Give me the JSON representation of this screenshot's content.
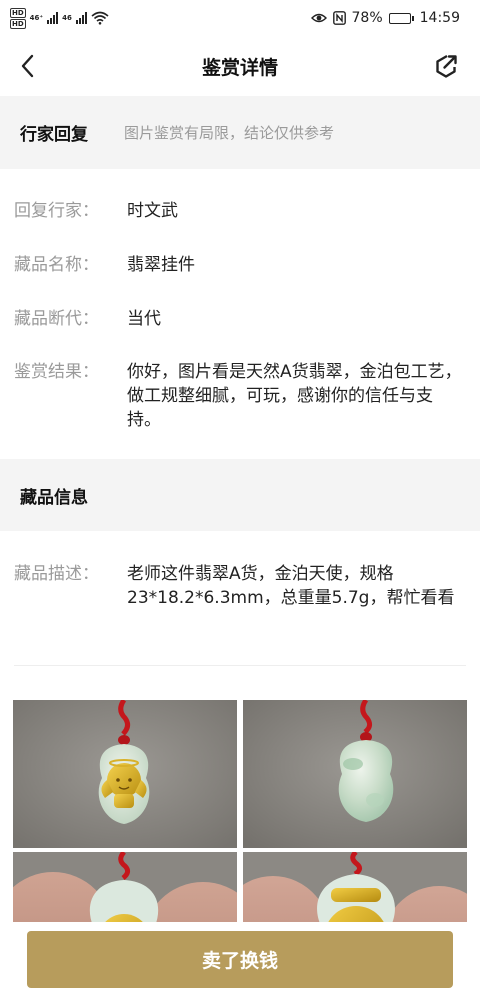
{
  "status": {
    "hd1": "HD",
    "hd2": "HD",
    "net1": "46⁺",
    "net2": "46",
    "battery": "78%",
    "time": "14:59",
    "battery_level": 0.78
  },
  "nav": {
    "title": "鉴赏详情",
    "back_icon": "chevron-left-icon",
    "share_icon": "share-icon"
  },
  "expert_section": {
    "title": "行家回复",
    "note": "图片鉴赏有局限，结论仅供参考"
  },
  "expert_rows": [
    {
      "label": "回复行家：",
      "value": "时文武"
    },
    {
      "label": "藏品名称：",
      "value": "翡翠挂件"
    },
    {
      "label": "藏品断代：",
      "value": "当代"
    },
    {
      "label": "鉴赏结果：",
      "value": "你好，图片看是天然A货翡翠，金泊包工艺，做工规整细腻，可玩，感谢你的信任与支持。"
    }
  ],
  "item_section": {
    "title": "藏品信息"
  },
  "item_rows": [
    {
      "label": "藏品描述：",
      "value": "老师这件翡翠A货，金泊天使，规格23*18.2*6.3mm，总重量5.7g，帮忙看看"
    }
  ],
  "photos": [
    {
      "name": "pendant-front-photo"
    },
    {
      "name": "pendant-back-photo"
    },
    {
      "name": "pendant-hand-photo-1"
    },
    {
      "name": "pendant-hand-photo-2"
    }
  ],
  "colors": {
    "accent": "#b79c5c",
    "section_bg": "#f4f4f4",
    "label": "#9a9a9a"
  },
  "bottom": {
    "sell_label": "卖了换钱"
  }
}
